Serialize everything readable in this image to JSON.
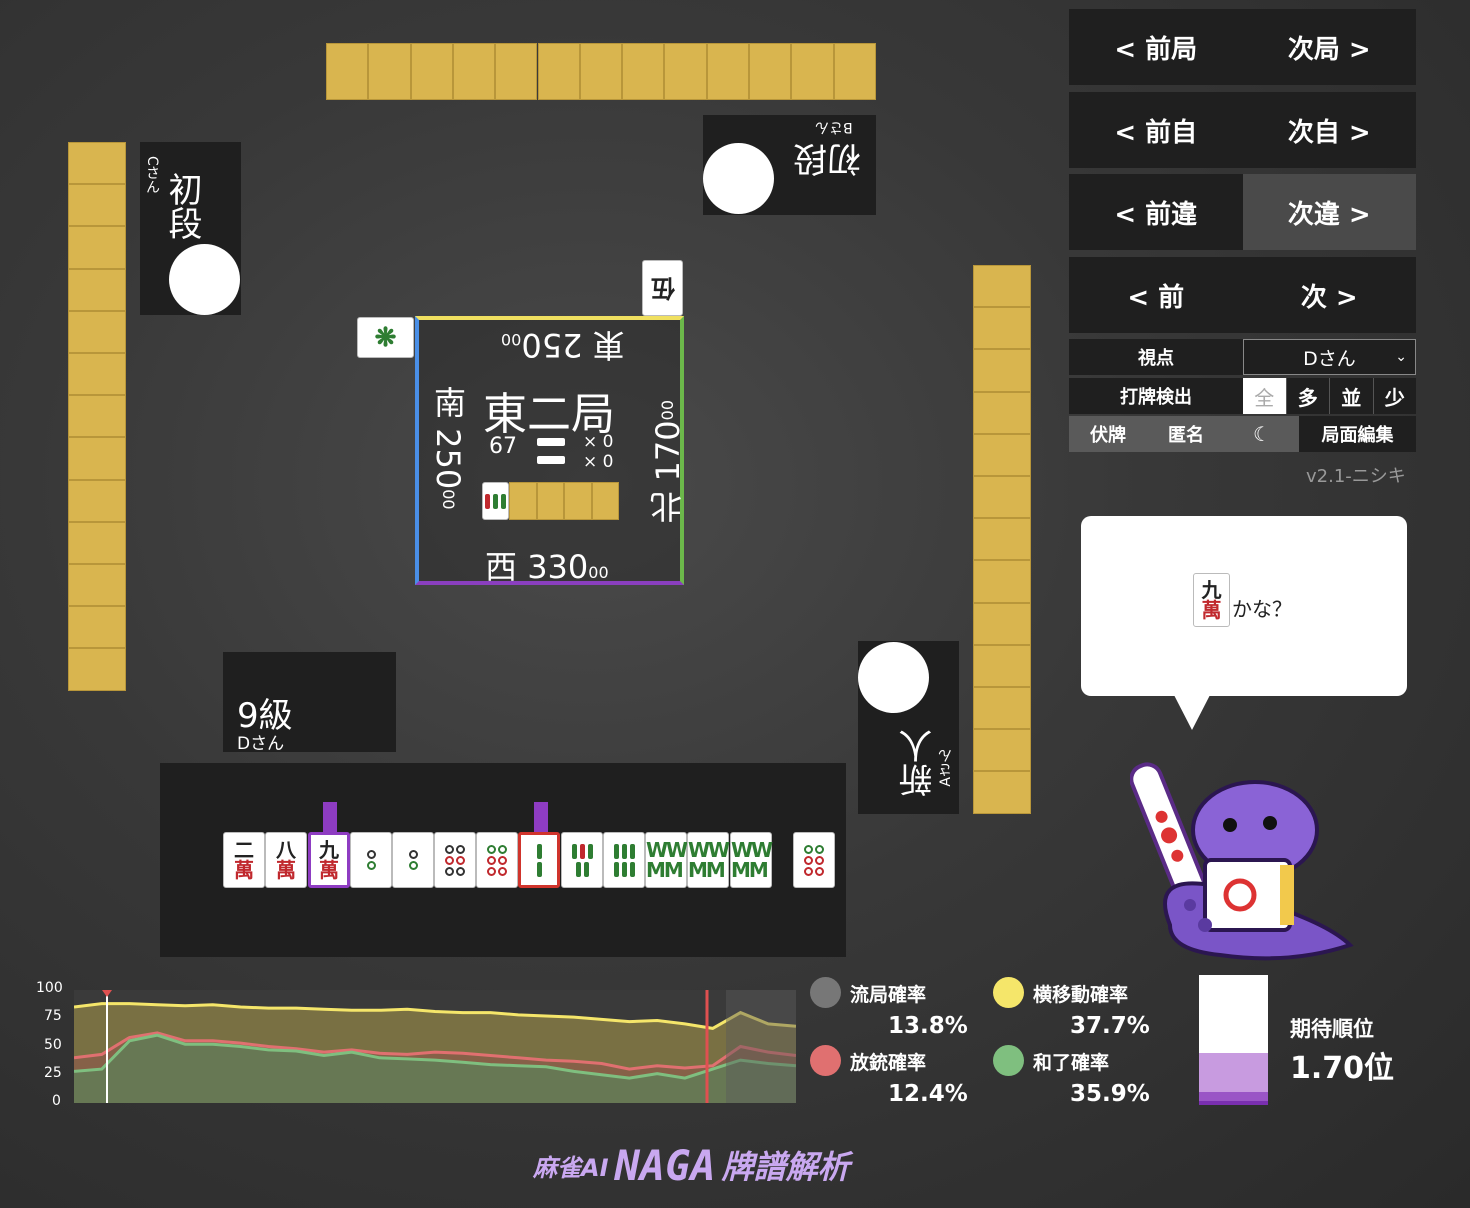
{
  "players": {
    "top": {
      "rank": "初段",
      "name": "Bさん"
    },
    "left": {
      "rank": "初段",
      "name": "Cさん"
    },
    "right": {
      "rank": "新人",
      "name": "Aさん"
    },
    "self": {
      "rank": "9級",
      "name": "Dさん"
    }
  },
  "center": {
    "round": "東二局",
    "honba": "67",
    "sticks": [
      "× 0",
      "× 0"
    ],
    "scores": {
      "east": {
        "wind": "東",
        "main": "250",
        "small": "00"
      },
      "south": {
        "wind": "南",
        "main": "250",
        "small": "00"
      },
      "west": {
        "wind": "西",
        "main": "330",
        "small": "00"
      },
      "north": {
        "wind": "北",
        "main": "170",
        "small": "00"
      }
    }
  },
  "nav": {
    "prev_round": "< 前局",
    "next_round": "次局 >",
    "prev_self": "< 前自",
    "next_self": "次自 >",
    "prev_diff": "< 前違",
    "next_diff": "次違 >",
    "prev": "< 前",
    "next": "次 >"
  },
  "settings": {
    "view_label": "視点",
    "view_value": "Dさん",
    "detect_label": "打牌検出",
    "detect_options": [
      "全",
      "多",
      "並",
      "少"
    ],
    "hide_tiles": "伏牌",
    "anonymous": "匿名",
    "edit": "局面編集",
    "version": "v2.1-ニシキ"
  },
  "hand": {
    "tiles": [
      {
        "top": "二",
        "bottom": "萬"
      },
      {
        "top": "八",
        "bottom": "萬"
      },
      {
        "top": "九",
        "bottom": "萬"
      }
    ]
  },
  "bubble": {
    "tile_top": "九",
    "tile_bottom": "萬",
    "text": "かな？"
  },
  "chart_data": {
    "type": "area",
    "yticks": [
      "100",
      "75",
      "50",
      "25",
      "0"
    ],
    "ylim": [
      0,
      100
    ],
    "series": [
      {
        "name": "横移動確率",
        "color": "#f5e66a",
        "values": [
          85,
          88,
          88,
          87,
          86,
          87,
          85,
          84,
          84,
          83,
          82,
          82,
          83,
          81,
          80,
          80,
          78,
          77,
          76,
          74,
          72,
          73,
          70,
          66,
          80,
          70,
          68
        ]
      },
      {
        "name": "放銃確率",
        "color": "#e07070",
        "values": [
          40,
          43,
          58,
          62,
          55,
          55,
          53,
          50,
          48,
          45,
          47,
          44,
          43,
          45,
          44,
          42,
          40,
          38,
          37,
          35,
          30,
          33,
          31,
          33,
          50,
          45,
          42
        ]
      },
      {
        "name": "和了確率",
        "color": "#7fbf7f",
        "values": [
          28,
          30,
          55,
          60,
          52,
          52,
          50,
          47,
          46,
          42,
          45,
          40,
          39,
          38,
          36,
          34,
          33,
          32,
          28,
          25,
          22,
          26,
          22,
          30,
          38,
          35,
          33
        ]
      }
    ],
    "stats": [
      {
        "label": "流局確率",
        "value": "13.8%",
        "color": "#777777"
      },
      {
        "label": "横移動確率",
        "value": "37.7%",
        "color": "#f5e66a"
      },
      {
        "label": "放銃確率",
        "value": "12.4%",
        "color": "#e07070"
      },
      {
        "label": "和了確率",
        "value": "35.9%",
        "color": "#7fbf7f"
      }
    ],
    "expected_rank_label": "期待順位",
    "expected_rank_value": "1.70位",
    "rank_distribution": [
      0.6,
      0.3,
      0.07,
      0.03
    ]
  },
  "footer": {
    "logo_a": "麻雀AI",
    "logo_b": "NAGA",
    "logo_c": "牌譜解析"
  }
}
